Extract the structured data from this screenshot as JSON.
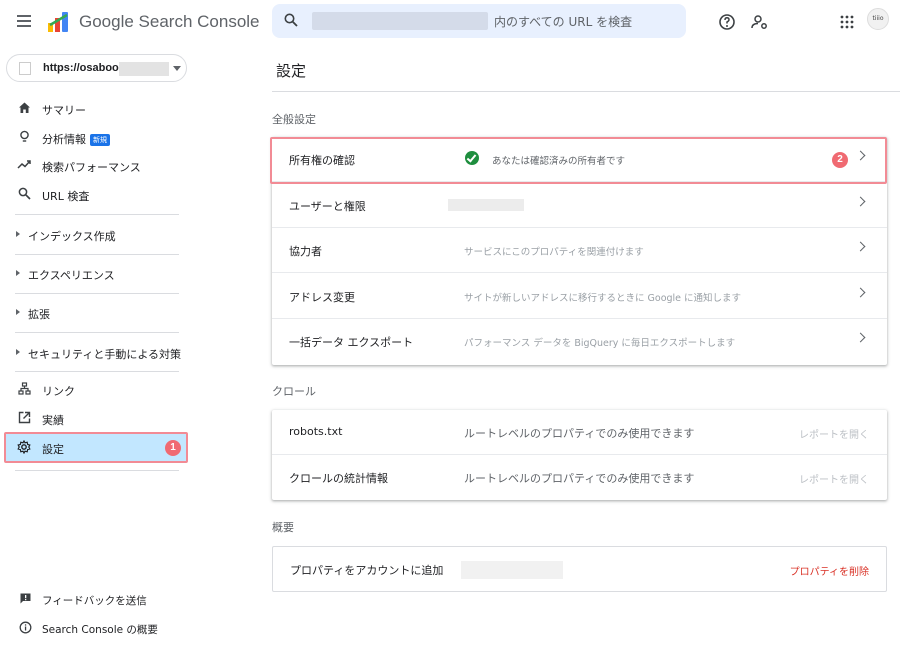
{
  "app": {
    "title": "Google Search Console",
    "search_placeholder": "内のすべての URL を検査",
    "avatar_text": "tiiio"
  },
  "property": {
    "url": "https://osaboo"
  },
  "sidebar": {
    "items": [
      {
        "label": "サマリー",
        "icon": "home-icon"
      },
      {
        "label": "分析情報",
        "icon": "lightbulb-icon",
        "badge": "新規"
      },
      {
        "label": "検索パフォーマンス",
        "icon": "trending-icon"
      },
      {
        "label": "URL 検査",
        "icon": "search-icon"
      }
    ],
    "sections": [
      {
        "label": "インデックス作成"
      },
      {
        "label": "エクスペリエンス"
      },
      {
        "label": "拡張"
      },
      {
        "label": "セキュリティと手動による対策"
      }
    ],
    "tools": [
      {
        "label": "リンク",
        "icon": "links-icon"
      },
      {
        "label": "実績",
        "icon": "external-link-icon"
      },
      {
        "label": "設定",
        "icon": "gear-icon"
      }
    ],
    "footer": [
      {
        "label": "フィードバックを送信",
        "icon": "feedback-icon"
      },
      {
        "label": "Search Console の概要",
        "icon": "info-icon"
      }
    ]
  },
  "annotations": {
    "badge1": "1",
    "badge2": "2"
  },
  "main": {
    "title": "設定",
    "general": {
      "header": "全般設定",
      "rows": [
        {
          "name": "所有権の確認",
          "desc": "あなたは確認済みの所有者です"
        },
        {
          "name": "ユーザーと権限",
          "desc": ""
        },
        {
          "name": "協力者",
          "desc": "サービスにこのプロパティを関連付けます"
        },
        {
          "name": "アドレス変更",
          "desc": "サイトが新しいアドレスに移行するときに Google に通知します"
        },
        {
          "name": "一括データ エクスポート",
          "desc": "パフォーマンス データを BigQuery に毎日エクスポートします"
        }
      ]
    },
    "crawl": {
      "header": "クロール",
      "rows": [
        {
          "name": "robots.txt",
          "desc": "ルートレベルのプロパティでのみ使用できます",
          "link": "レポートを開く"
        },
        {
          "name": "クロールの統計情報",
          "desc": "ルートレベルのプロパティでのみ使用できます",
          "link": "レポートを開く"
        }
      ]
    },
    "overview": {
      "header": "概要",
      "name": "プロパティをアカウントに追加",
      "delete": "プロパティを削除"
    }
  },
  "colors": {
    "accent": "#1a73e8",
    "active_bg": "#c2e7ff",
    "highlight": "#f28b95",
    "success": "#1e8e3e",
    "danger": "#d93025"
  }
}
